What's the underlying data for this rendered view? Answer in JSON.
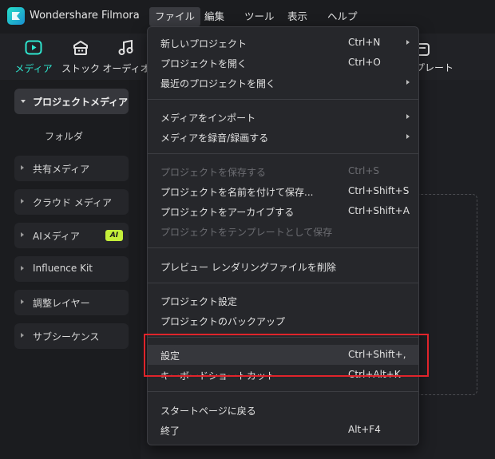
{
  "app": {
    "title": "Wondershare Filmora"
  },
  "menubar": [
    "ファイル",
    "編集",
    "ツール",
    "表示",
    "ヘルプ"
  ],
  "toolbar": {
    "media": "メディア",
    "stock": "ストック",
    "audio": "オーディオ",
    "template": "プレート"
  },
  "sidebar": {
    "project_media": "プロジェクトメディア",
    "folder": "フォルダ",
    "shared_media": "共有メディア",
    "cloud_media": "クラウド メディア",
    "ai_media": "AIメディア",
    "ai_badge": "AI",
    "influence_kit": "Influence Kit",
    "adjustment_layer": "調整レイヤー",
    "subsequence": "サブシーケンス"
  },
  "file_menu": {
    "new_project": {
      "label": "新しいプロジェクト",
      "shortcut": "Ctrl+N"
    },
    "open_project": {
      "label": "プロジェクトを開く",
      "shortcut": "Ctrl+O"
    },
    "recent_project": {
      "label": "最近のプロジェクトを開く"
    },
    "import_media": {
      "label": "メディアをインポート"
    },
    "record_media": {
      "label": "メディアを録音/録画する"
    },
    "save_project": {
      "label": "プロジェクトを保存する",
      "shortcut": "Ctrl+S"
    },
    "save_as": {
      "label": "プロジェクトを名前を付けて保存...",
      "shortcut": "Ctrl+Shift+S"
    },
    "archive": {
      "label": "プロジェクトをアーカイブする",
      "shortcut": "Ctrl+Shift+A"
    },
    "save_template": {
      "label": "プロジェクトをテンプレートとして保存"
    },
    "delete_preview": {
      "label": "プレビュー レンダリングファイルを削除"
    },
    "project_settings": {
      "label": "プロジェクト設定"
    },
    "project_backup": {
      "label": "プロジェクトのバックアップ"
    },
    "settings": {
      "label": "設定",
      "shortcut": "Ctrl+Shift+,"
    },
    "keyboard_shortcuts": {
      "label": "キーボードショートカット",
      "shortcut": "Ctrl+Alt+K"
    },
    "back_to_start": {
      "label": "スタートページに戻る"
    },
    "exit": {
      "label": "終了",
      "shortcut": "Alt+F4"
    }
  },
  "colors": {
    "accent": "#2ee6cf",
    "highlight_box": "#e0242b",
    "ai_badge": "#c4ef3a"
  }
}
